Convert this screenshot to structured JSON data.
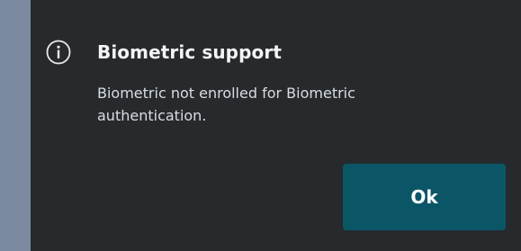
{
  "dialog": {
    "icon": "info-icon",
    "title": "Biometric support",
    "message": "Biometric not enrolled for Biometric authentication.",
    "ok_label": "Ok"
  },
  "colors": {
    "dialog_background": "#262a2d",
    "button_background": "#0a5667",
    "left_strip": "#7b8aa0",
    "text_primary": "#f2f4f5"
  }
}
